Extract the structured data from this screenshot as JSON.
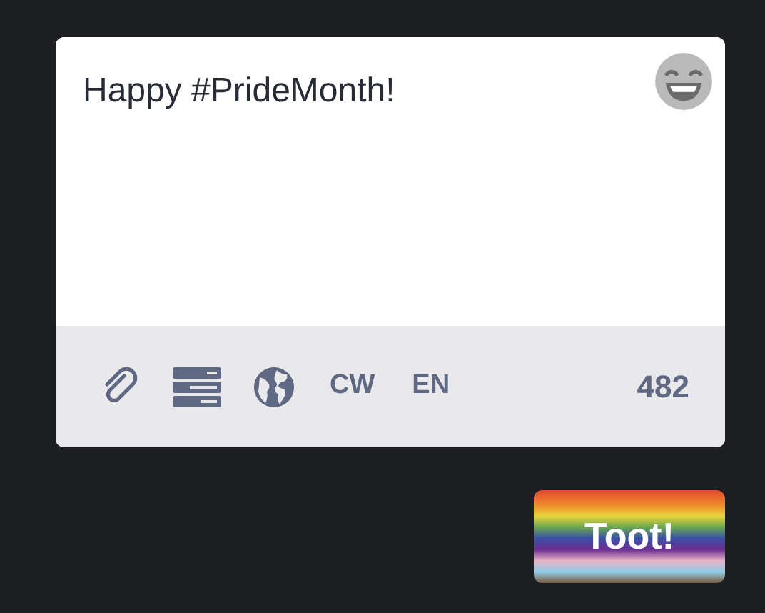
{
  "compose": {
    "text": "Happy #PrideMonth!",
    "toolbar": [
      {
        "kind": "attach"
      },
      {
        "kind": "poll"
      },
      {
        "kind": "visibility"
      },
      {
        "kind": "text",
        "label": "CW"
      },
      {
        "kind": "text",
        "label": "EN"
      }
    ],
    "char_count": "482"
  },
  "submit": {
    "label": "Toot!"
  }
}
